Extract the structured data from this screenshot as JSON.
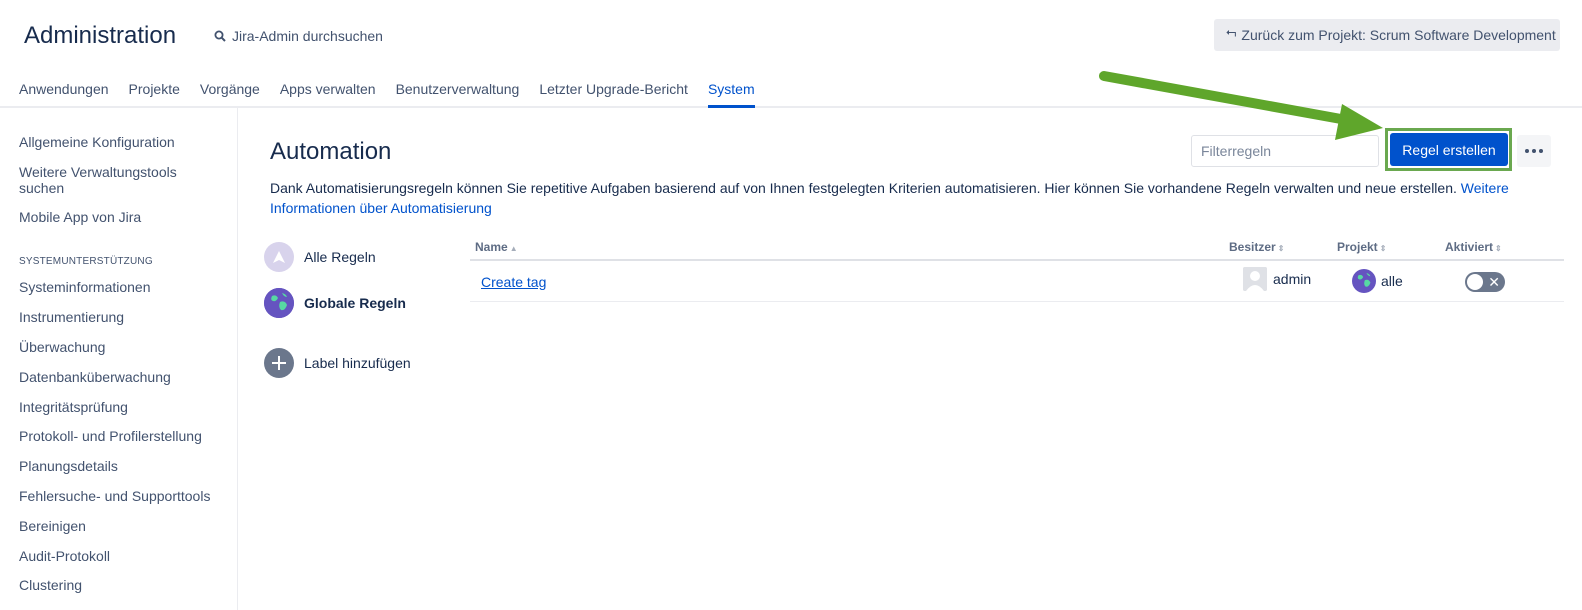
{
  "header": {
    "title": "Administration",
    "search_label": "Jira-Admin durchsuchen",
    "back_label": "Zurück zum Projekt: Scrum Software Development"
  },
  "nav": {
    "items": [
      "Anwendungen",
      "Projekte",
      "Vorgänge",
      "Apps verwalten",
      "Benutzerverwaltung",
      "Letzter Upgrade-Bericht",
      "System"
    ],
    "active": "System"
  },
  "sidebar": {
    "items_top": [
      "Allgemeine Konfiguration",
      "Weitere Verwaltungstools suchen",
      "Mobile App von Jira"
    ],
    "section_title": "SYSTEMUNTERSTÜTZUNG",
    "items": [
      "Systeminformationen",
      "Instrumentierung",
      "Überwachung",
      "Datenbanküberwachung",
      "Integritätsprüfung",
      "Protokoll- und Profilerstellung",
      "Planungsdetails",
      "Fehlersuche- und Supporttools",
      "Bereinigen",
      "Audit-Protokoll",
      "Clustering"
    ]
  },
  "main": {
    "title": "Automation",
    "filter_placeholder": "Filterregeln",
    "create_label": "Regel erstellen",
    "description": "Dank Automatisierungsregeln können Sie repetitive Aufgaben basierend auf von Ihnen festgelegten Kriterien automatisieren. Hier können Sie vorhandene Regeln verwalten und neue erstellen.",
    "description_link": "Weitere Informationen über Automatisierung"
  },
  "categories": {
    "all": "Alle Regeln",
    "global": "Globale Regeln",
    "add_label": "Label hinzufügen"
  },
  "table": {
    "columns": {
      "name": "Name",
      "owner": "Besitzer",
      "project": "Projekt",
      "enabled": "Aktiviert"
    },
    "rows": [
      {
        "name": "Create tag",
        "owner": "admin",
        "project": "alle",
        "enabled": false
      }
    ]
  },
  "colors": {
    "accent": "#0052cc",
    "highlight": "#6aa84f",
    "arrow": "#5fa62b"
  }
}
